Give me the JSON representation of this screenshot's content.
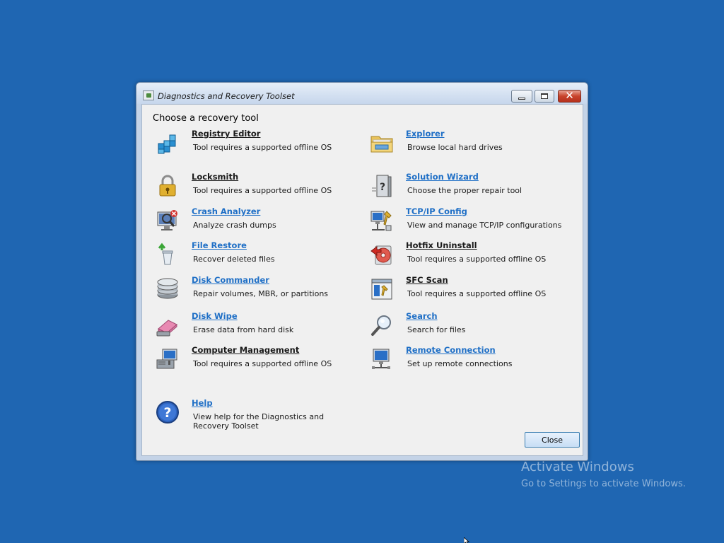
{
  "window": {
    "title": "Diagnostics and Recovery Toolset",
    "heading": "Choose a recovery tool"
  },
  "tools": [
    {
      "name": "Registry Editor",
      "desc": "Tool requires a supported offline OS",
      "icon": "registry-icon"
    },
    {
      "name": "Explorer",
      "desc": "Browse local hard drives",
      "icon": "folder-icon"
    },
    {
      "name": "Locksmith",
      "desc": "Tool requires a supported offline OS",
      "icon": "padlock-icon"
    },
    {
      "name": "Solution Wizard",
      "desc": "Choose the proper repair tool",
      "icon": "tower-question-icon"
    },
    {
      "name": "Crash Analyzer",
      "desc": "Analyze crash dumps",
      "icon": "crash-monitor-icon"
    },
    {
      "name": "TCP/IP Config",
      "desc": "View and manage TCP/IP configurations",
      "icon": "network-config-icon"
    },
    {
      "name": "File Restore",
      "desc": "Recover deleted files",
      "icon": "recycle-bin-icon"
    },
    {
      "name": "Hotfix Uninstall",
      "desc": "Tool requires a supported offline OS",
      "icon": "hotfix-disc-icon"
    },
    {
      "name": "Disk Commander",
      "desc": "Repair volumes, MBR, or partitions",
      "icon": "disk-stack-icon"
    },
    {
      "name": "SFC Scan",
      "desc": "Tool requires a supported offline OS",
      "icon": "sfc-window-icon"
    },
    {
      "name": "Disk Wipe",
      "desc": "Erase data from hard disk",
      "icon": "eraser-icon"
    },
    {
      "name": "Search",
      "desc": "Search for files",
      "icon": "magnifier-icon"
    },
    {
      "name": "Computer Management",
      "desc": "Tool requires a supported offline OS",
      "icon": "computer-management-icon"
    },
    {
      "name": "Remote Connection",
      "desc": "Set up remote connections",
      "icon": "remote-monitor-icon"
    }
  ],
  "help": {
    "name": "Help",
    "desc": "View help for the Diagnostics and Recovery Toolset",
    "icon": "help-icon"
  },
  "buttons": {
    "close": "Close"
  },
  "watermark": {
    "title": "Activate Windows",
    "subtitle": "Go to Settings to activate Windows."
  },
  "colors": {
    "desktop": "#1f66b2",
    "link_blue": "#1f6fc6",
    "link_dark": "#1a1a1a"
  }
}
